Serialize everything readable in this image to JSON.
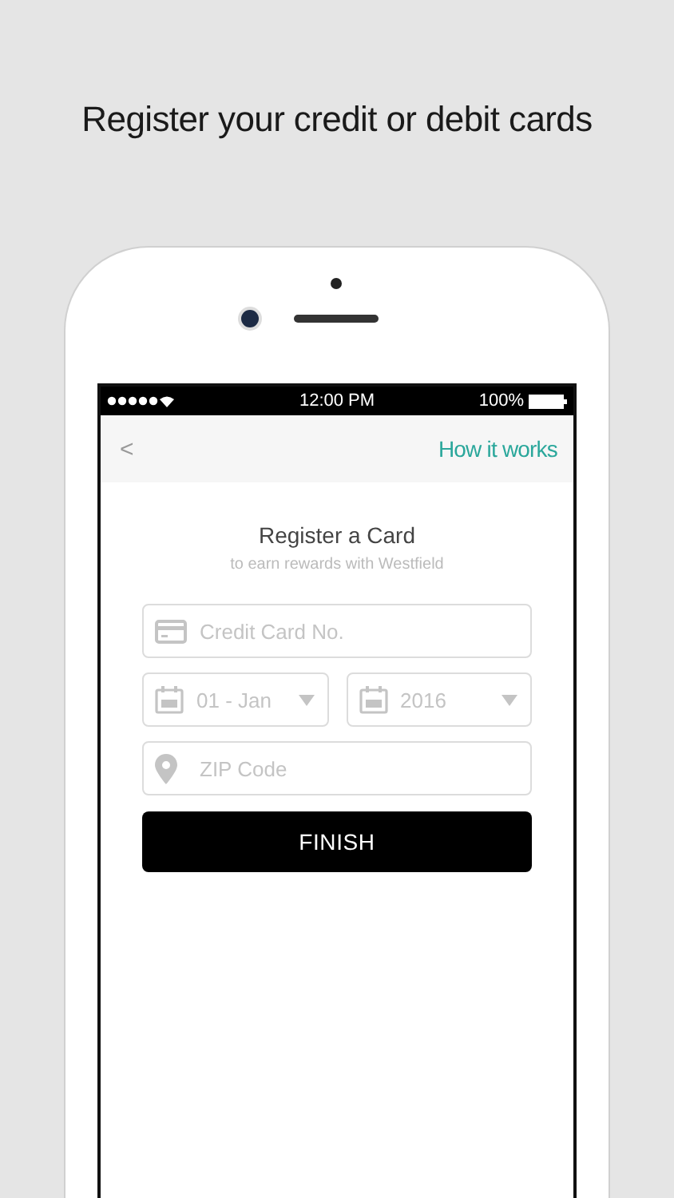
{
  "headline": "Register your credit or debit cards",
  "status_bar": {
    "time": "12:00 PM",
    "battery": "100%"
  },
  "nav": {
    "back": "<",
    "action": "How it works"
  },
  "form": {
    "title": "Register a Card",
    "subtitle": "to earn rewards with Westfield",
    "fields": [
      {
        "kind": "card",
        "placeholder": "Credit Card No."
      },
      {
        "kind": "date",
        "value": "01 - Jan"
      },
      {
        "kind": "date",
        "value": "2016"
      },
      {
        "kind": "zip",
        "placeholder": "ZIP Code"
      }
    ],
    "submit": "FINISH"
  }
}
